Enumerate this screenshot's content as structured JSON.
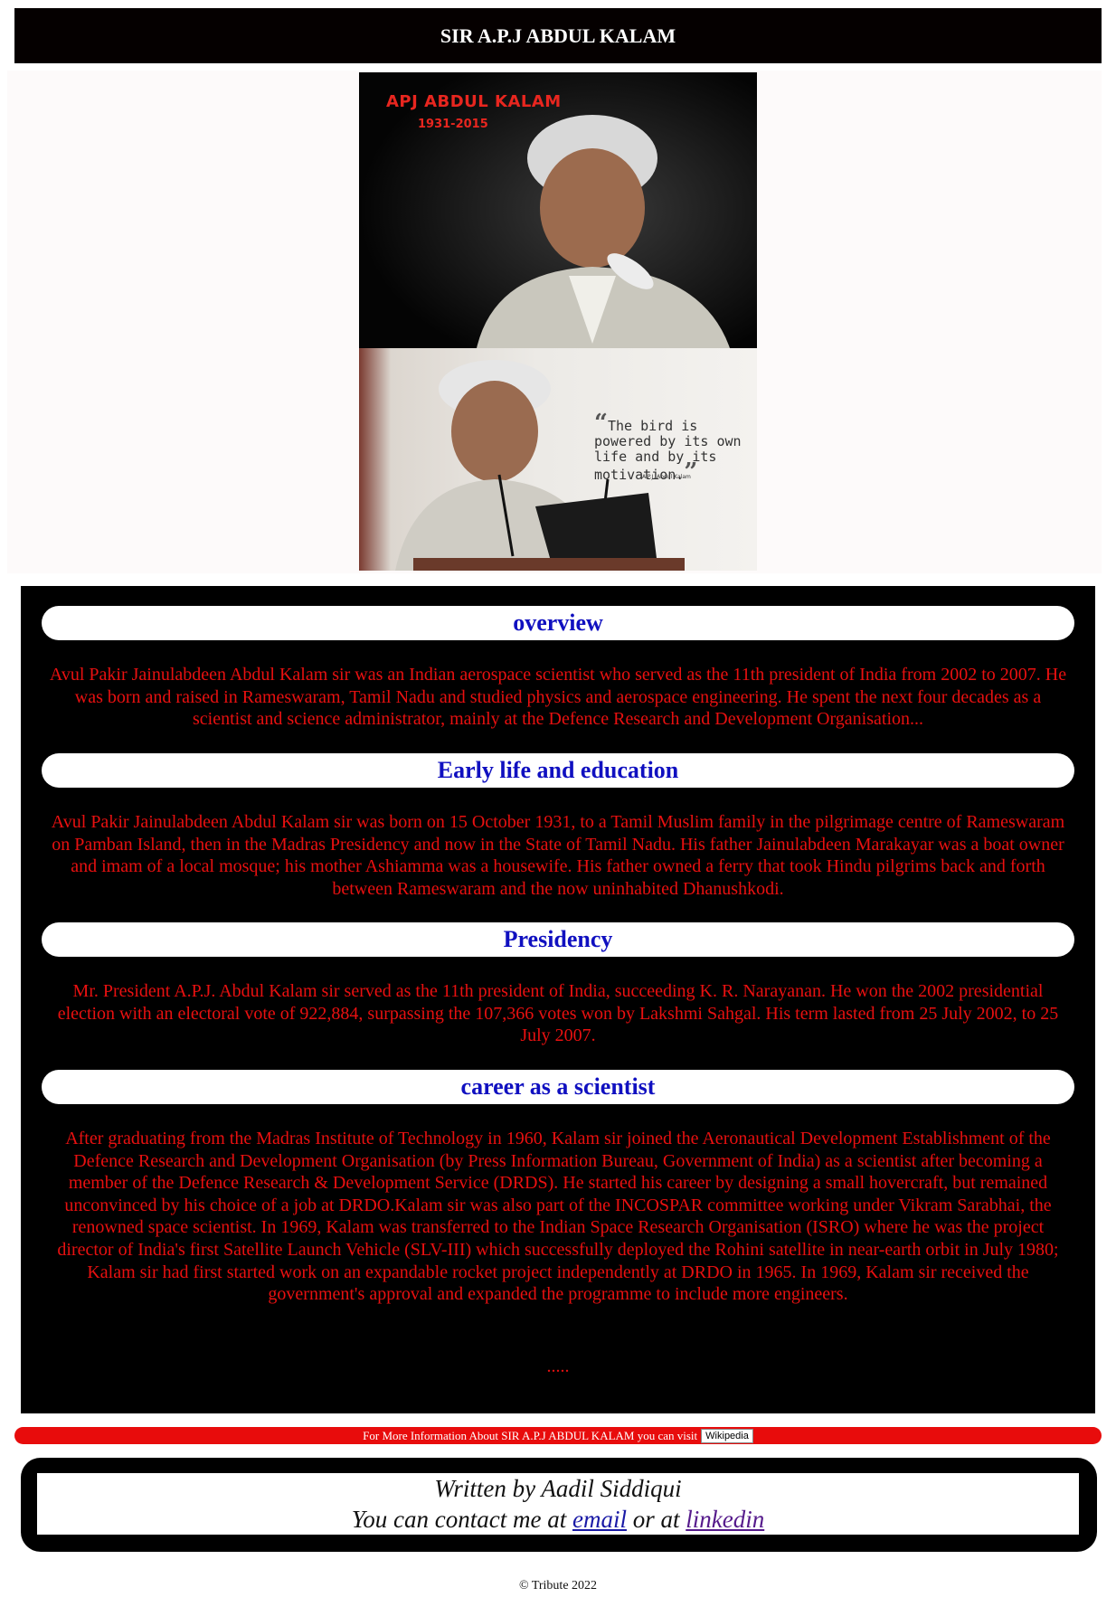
{
  "header": {
    "title": "SIR A.P.J ABDUL KALAM"
  },
  "hero": {
    "photo1": {
      "title": "APJ ABDUL KALAM",
      "years": "1931-2015"
    },
    "photo2": {
      "quote": "The bird is powered by its own life and by its motivation.",
      "author": "A.P.J. Abdul Kalam"
    }
  },
  "sections": [
    {
      "heading": "overview",
      "text": "Avul Pakir Jainulabdeen Abdul Kalam sir was an Indian aerospace scientist who served as the 11th president of India from 2002 to 2007. He was born and raised in Rameswaram, Tamil Nadu and studied physics and aerospace engineering. He spent the next four decades as a scientist and science administrator, mainly at the Defence Research and Development Organisation..."
    },
    {
      "heading": "Early life and education",
      "text": "Avul Pakir Jainulabdeen Abdul Kalam sir was born on 15 October 1931, to a Tamil Muslim family in the pilgrimage centre of Rameswaram on Pamban Island, then in the Madras Presidency and now in the State of Tamil Nadu. His father Jainulabdeen Marakayar was a boat owner and imam of a local mosque; his mother Ashiamma was a housewife. His father owned a ferry that took Hindu pilgrims back and forth between Rameswaram and the now uninhabited Dhanushkodi."
    },
    {
      "heading": "Presidency",
      "text": "Mr. President A.P.J. Abdul Kalam sir served as the 11th president of India, succeeding K. R. Narayanan. He won the 2002 presidential election with an electoral vote of 922,884, surpassing the 107,366 votes won by Lakshmi Sahgal. His term lasted from 25 July 2002, to 25 July 2007."
    },
    {
      "heading": "career as a scientist",
      "text": "After graduating from the Madras Institute of Technology in 1960, Kalam sir joined the Aeronautical Development Establishment of the Defence Research and Development Organisation (by Press Information Bureau, Government of India) as a scientist after becoming a member of the Defence Research & Development Service (DRDS). He started his career by designing a small hovercraft, but remained unconvinced by his choice of a job at DRDO.Kalam sir was also part of the INCOSPAR committee working under Vikram Sarabhai, the renowned space scientist. In 1969, Kalam was transferred to the Indian Space Research Organisation (ISRO) where he was the project director of India's first Satellite Launch Vehicle (SLV-III) which successfully deployed the Rohini satellite in near-earth orbit in July 1980; Kalam sir had first started work on an expandable rocket project independently at DRDO in 1965. In 1969, Kalam sir received the government's approval and expanded the programme to include more engineers."
    }
  ],
  "ellipsis": ".....",
  "infobar": {
    "text": "For More Information About SIR A.P.J ABDUL KALAM you can visit",
    "button_label": "Wikipedia"
  },
  "author": {
    "line1": "Written by Aadil Siddiqui",
    "line2_prefix": "You can contact me at",
    "email_label": "email",
    "line2_middle": "or at",
    "linkedin_label": "linkedin"
  },
  "footer": {
    "copyright": "© Tribute 2022"
  }
}
